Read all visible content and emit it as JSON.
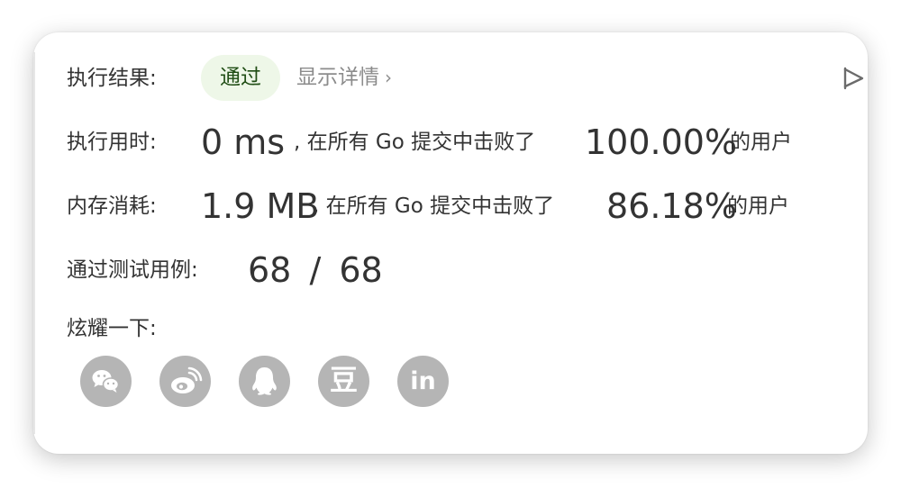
{
  "result": {
    "label": "执行结果:",
    "status": "通过",
    "details_link": "显示详情",
    "details_chevron": "›"
  },
  "runtime": {
    "label": "执行用时:",
    "value": "0 ms",
    "middle_text": ", 在所有 Go 提交中击败了",
    "percent": "100.00%",
    "suffix": "的用户"
  },
  "memory": {
    "label": "内存消耗:",
    "value": "1.9 MB",
    "middle_text": ", 在所有 Go 提交中击败了",
    "percent": "86.18%",
    "suffix": "的用户"
  },
  "tests": {
    "label": "通过测试用例:",
    "passed": "68",
    "separator": "/",
    "total": "68"
  },
  "share": {
    "label": "炫耀一下:",
    "icons": [
      "wechat-icon",
      "weibo-icon",
      "qq-icon",
      "douban-icon",
      "linkedin-icon"
    ],
    "douban_glyph": "豆",
    "linkedin_glyph": "in"
  },
  "colors": {
    "pass_pill_bg": "#eef7e8",
    "pass_pill_text": "#1f4d14",
    "social_icon_bg": "#b5b5b5"
  }
}
